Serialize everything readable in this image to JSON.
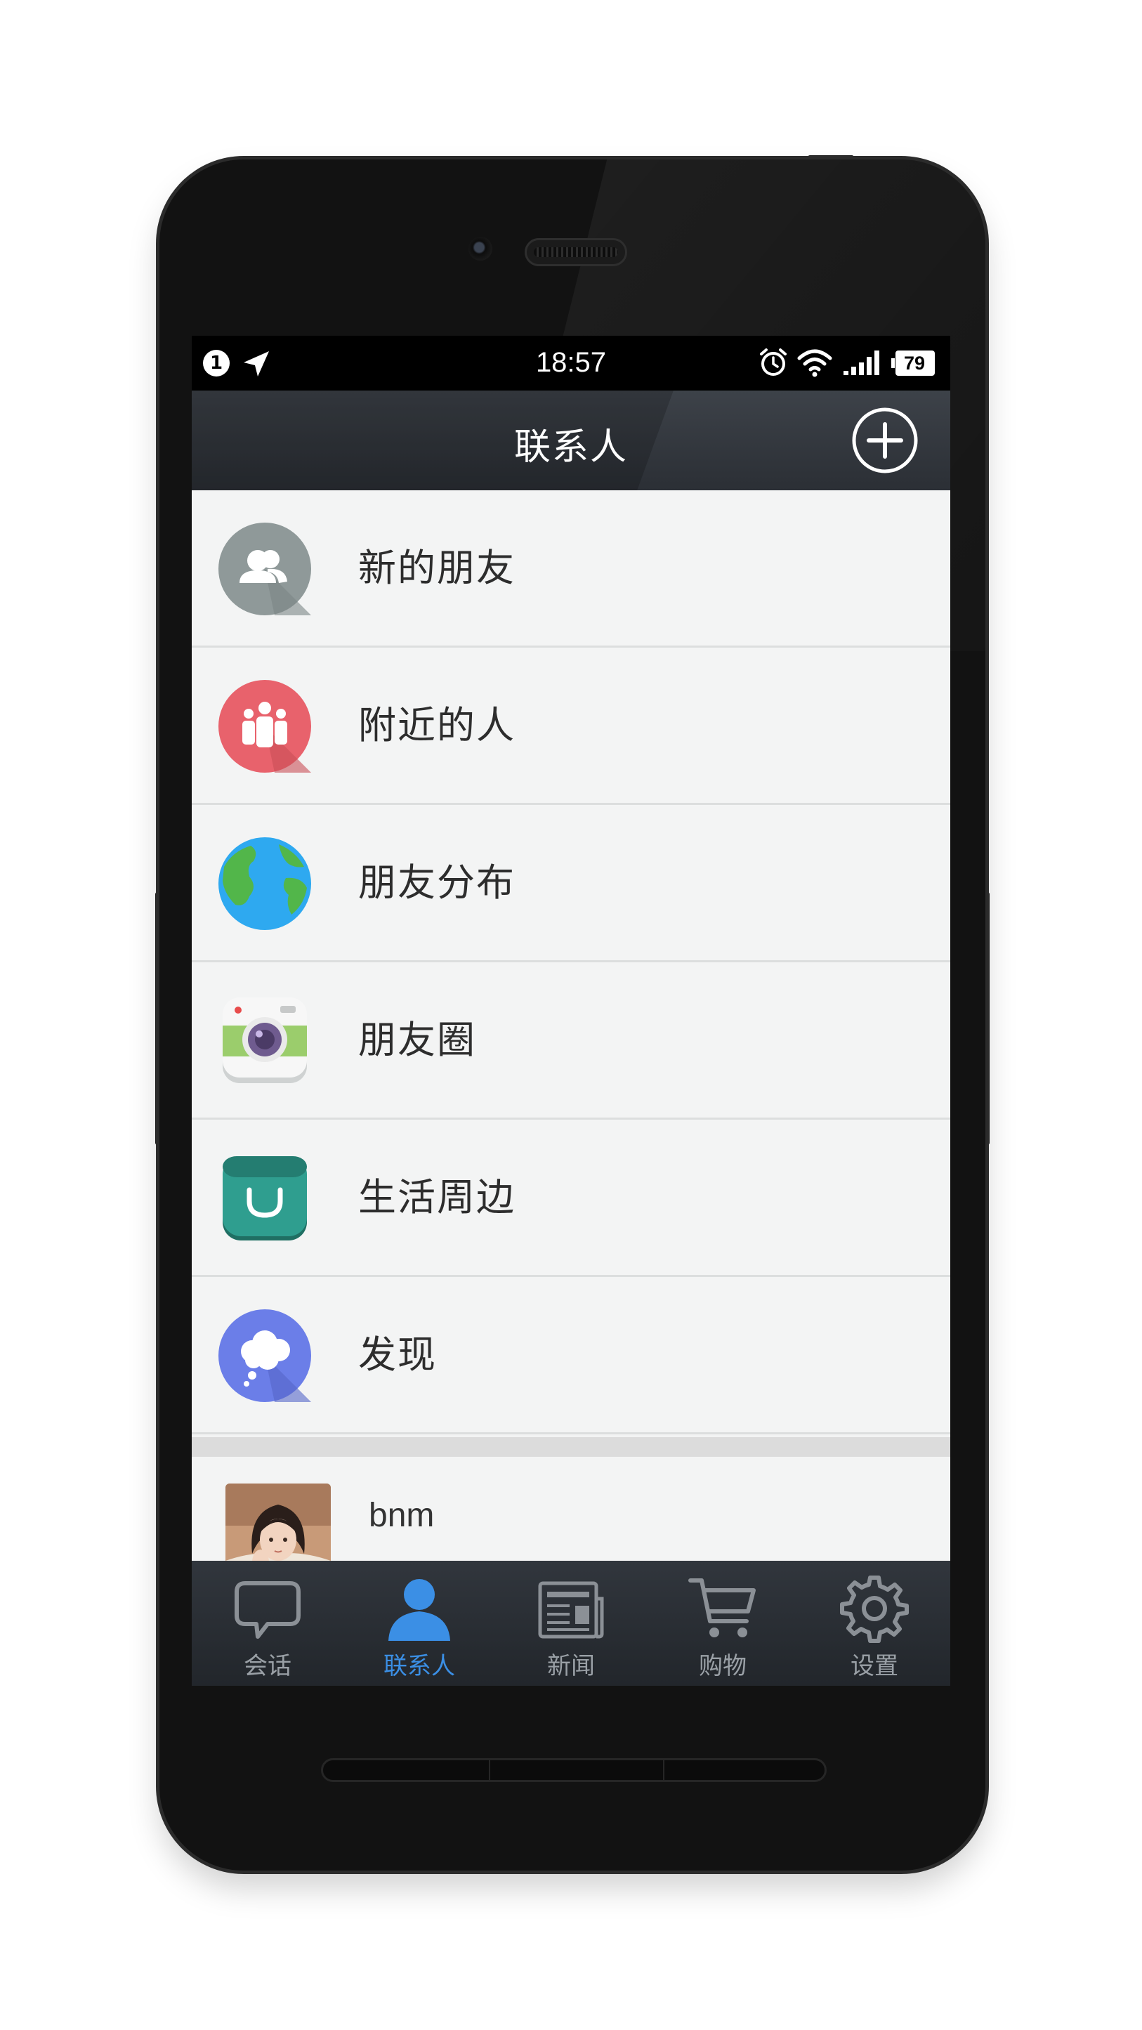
{
  "status_bar": {
    "notification_count": "1",
    "time": "18:57",
    "battery": "79",
    "icons": [
      "notification-badge-icon",
      "location-arrow-icon",
      "alarm-clock-icon",
      "wifi-icon",
      "cellular-signal-icon",
      "battery-icon"
    ]
  },
  "nav": {
    "title": "联系人",
    "add_icon": "add-circle-icon"
  },
  "menu": [
    {
      "label": "新的朋友",
      "icon": "new-friends-icon",
      "color": "#8e9898"
    },
    {
      "label": "附近的人",
      "icon": "nearby-people-icon",
      "color": "#e9616b"
    },
    {
      "label": "朋友分布",
      "icon": "globe-icon",
      "color": "#2eaaf0"
    },
    {
      "label": "朋友圈",
      "icon": "camera-icon",
      "color": "#9bcf6b"
    },
    {
      "label": "生活周边",
      "icon": "shopping-bag-icon",
      "color": "#2f9e8f"
    },
    {
      "label": "发现",
      "icon": "cloud-bubble-icon",
      "color": "#6a7de8"
    }
  ],
  "contacts": [
    {
      "name": "bnm",
      "avatar": "contact-photo"
    }
  ],
  "tabs": [
    {
      "label": "会话",
      "icon": "chat-bubble-icon",
      "active": false
    },
    {
      "label": "联系人",
      "icon": "person-icon",
      "active": true
    },
    {
      "label": "新闻",
      "icon": "newspaper-icon",
      "active": false
    },
    {
      "label": "购物",
      "icon": "shopping-cart-icon",
      "active": false
    },
    {
      "label": "设置",
      "icon": "gear-icon",
      "active": false
    }
  ],
  "colors": {
    "accent": "#3b8fe5",
    "tab_inactive": "#9aa0a6",
    "list_background": "#f3f4f4",
    "header_background": "#32363d"
  }
}
